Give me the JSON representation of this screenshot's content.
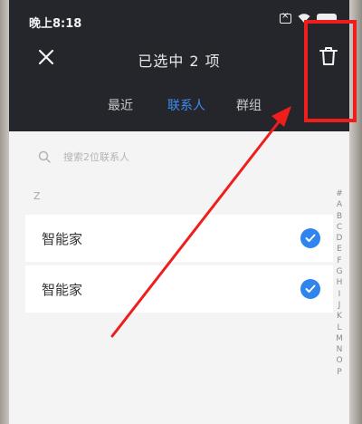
{
  "status_bar": {
    "time": "晚上8:18"
  },
  "header": {
    "title": "已选中 2 项",
    "close_icon": "close-icon",
    "delete_icon": "trash-icon"
  },
  "tabs": [
    {
      "label": "最近",
      "active": false
    },
    {
      "label": "联系人",
      "active": true
    },
    {
      "label": "群组",
      "active": false
    }
  ],
  "search": {
    "placeholder": "搜索2位联系人"
  },
  "section": {
    "header": "Z"
  },
  "contacts": [
    {
      "name": "智能家",
      "selected": true
    },
    {
      "name": "智能家",
      "selected": true
    }
  ],
  "alpha_index": [
    "#",
    "A",
    "B",
    "C",
    "D",
    "E",
    "F",
    "G",
    "H",
    "I",
    "J",
    "K",
    "L",
    "M",
    "N",
    "O",
    "P"
  ],
  "colors": {
    "accent": "#2f84ee",
    "annotation": "#f01d1d",
    "header_bg": "#25262b"
  }
}
